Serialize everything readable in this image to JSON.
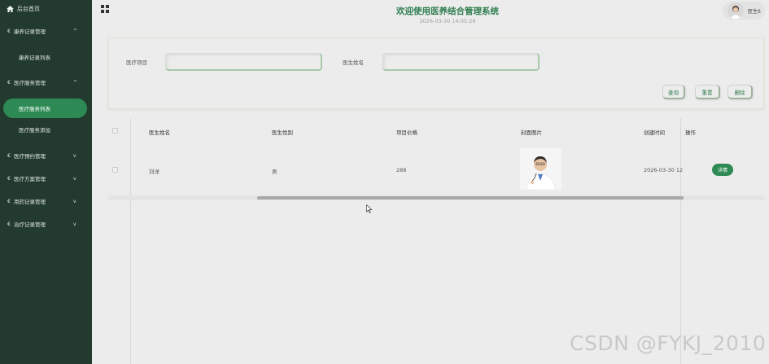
{
  "sidebar": {
    "home": "后台首页",
    "groups": [
      {
        "label": "康养记录管理",
        "chevron": "^"
      },
      {
        "label": "医疗服务管理",
        "chevron": "^"
      },
      {
        "label": "医疗预约管理",
        "chevron": "v"
      },
      {
        "label": "医疗方案管理",
        "chevron": "v"
      },
      {
        "label": "用药记录管理",
        "chevron": "v"
      },
      {
        "label": "治疗记录管理",
        "chevron": "v"
      }
    ],
    "subitems": {
      "kangyang_list": "康养记录列表",
      "service_list": "医疗服务列表",
      "service_add": "医疗服务添加"
    },
    "euro": "€"
  },
  "header": {
    "title": "欢迎使用医养结合管理系统",
    "time": "2026-03-30 14:05:26",
    "user": "医生6"
  },
  "search": {
    "project_label": "医疗项目",
    "project_value": "",
    "doctor_label": "医生姓名",
    "doctor_value": "",
    "query_btn": "查询",
    "reset_btn": "重置",
    "delete_btn": "删除"
  },
  "table": {
    "headers": [
      "医生姓名",
      "医生性别",
      "项目价格",
      "封面图片",
      "创建时间",
      "操作"
    ],
    "rows": [
      {
        "name": "刘洋",
        "gender": "男",
        "price": "288",
        "created": "2026-03-30 12",
        "action": "详情"
      }
    ]
  },
  "watermark": "CSDN @FYKJ_2010",
  "colors": {
    "sidebar_bg": "#233a2e",
    "accent": "#2e8a55",
    "title": "#2e7d4f"
  }
}
